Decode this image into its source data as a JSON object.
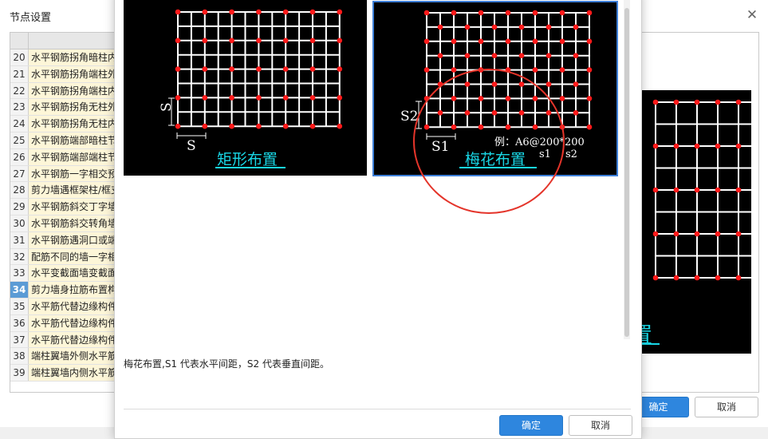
{
  "background_dialog": {
    "title": "节点设置",
    "close_glyph": "✕",
    "rows": [
      {
        "num": "20",
        "text": "水平钢筋拐角暗柱内"
      },
      {
        "num": "21",
        "text": "水平钢筋拐角端柱外"
      },
      {
        "num": "22",
        "text": "水平钢筋拐角端柱内"
      },
      {
        "num": "23",
        "text": "水平钢筋拐角无柱外"
      },
      {
        "num": "24",
        "text": "水平钢筋拐角无柱内"
      },
      {
        "num": "25",
        "text": "水平钢筋端部暗柱节"
      },
      {
        "num": "26",
        "text": "水平钢筋端部端柱节"
      },
      {
        "num": "27",
        "text": "水平钢筋一字相交预"
      },
      {
        "num": "28",
        "text": "剪力墙遇框架柱/框支"
      },
      {
        "num": "29",
        "text": "水平钢筋斜交丁字墙"
      },
      {
        "num": "30",
        "text": "水平钢筋斜交转角墙"
      },
      {
        "num": "31",
        "text": "水平钢筋遇洞口或端"
      },
      {
        "num": "32",
        "text": "配筋不同的墙一字相"
      },
      {
        "num": "33",
        "text": "水平变截面墙变截面"
      },
      {
        "num": "34",
        "text": "剪力墙身拉筋布置构",
        "selected": true
      },
      {
        "num": "35",
        "text": "水平筋代替边缘构件"
      },
      {
        "num": "36",
        "text": "水平筋代替边缘构件"
      },
      {
        "num": "37",
        "text": "水平筋代替边缘构件"
      },
      {
        "num": "38",
        "text": "端柱翼墙外侧水平筋"
      },
      {
        "num": "39",
        "text": "端柱翼墙内侧水平筋"
      }
    ],
    "right_label_partial": "置",
    "ok_label": "确定",
    "cancel_label": "取消"
  },
  "foreground_dialog": {
    "option_rect": {
      "caption": "矩形布置",
      "dim_s_vertical": "S",
      "dim_s_horizontal": "S"
    },
    "option_plum": {
      "caption": "梅花布置",
      "dim_s2": "S2",
      "dim_s1": "S1",
      "example_text": "例：A6@200*200",
      "legend_s1": "s1",
      "legend_s2": "s2",
      "selected": true
    },
    "description": "梅花布置,S1 代表水平间距，S2 代表垂直间距。",
    "ok_label": "确定",
    "cancel_label": "取消"
  },
  "colors": {
    "grid_line": "#ffffff",
    "tie_dot": "#ff1a1a",
    "caption_cyan": "#19d7e6",
    "selection_border": "#3d7fd8",
    "annotation_circle": "#e4342a",
    "primary_button": "#2e86de",
    "row_text_bg": "#fdf6d8"
  }
}
